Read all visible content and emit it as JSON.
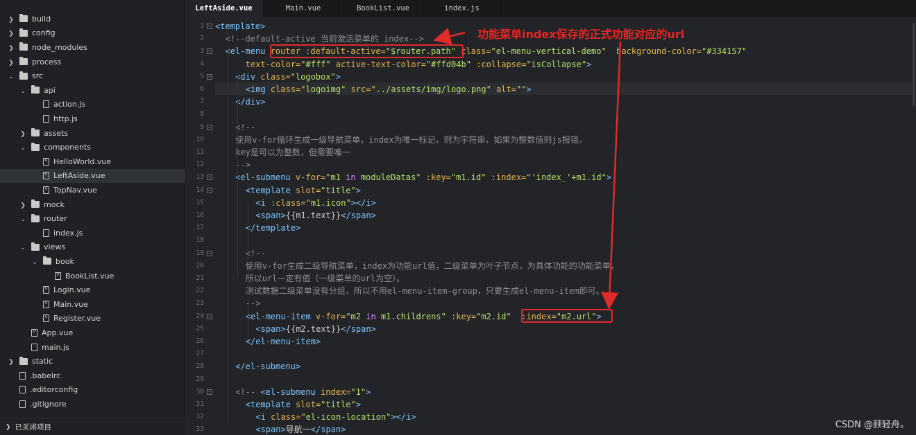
{
  "tabs": [
    {
      "label": "LeftAside.vue",
      "active": true
    },
    {
      "label": "Main.vue",
      "active": false
    },
    {
      "label": "BookList.vue",
      "active": false
    },
    {
      "label": "index.js",
      "active": false
    }
  ],
  "tree": [
    {
      "label": "build",
      "type": "folder",
      "depth": 0,
      "state": "collapsed"
    },
    {
      "label": "config",
      "type": "folder",
      "depth": 0,
      "state": "collapsed"
    },
    {
      "label": "node_modules",
      "type": "folder",
      "depth": 0,
      "state": "collapsed"
    },
    {
      "label": "process",
      "type": "folder",
      "depth": 0,
      "state": "collapsed"
    },
    {
      "label": "src",
      "type": "folder",
      "depth": 0,
      "state": "expanded"
    },
    {
      "label": "api",
      "type": "folder",
      "depth": 1,
      "state": "expanded"
    },
    {
      "label": "action.js",
      "type": "file",
      "depth": 2
    },
    {
      "label": "http.js",
      "type": "file",
      "depth": 2
    },
    {
      "label": "assets",
      "type": "folder",
      "depth": 1,
      "state": "collapsed"
    },
    {
      "label": "components",
      "type": "folder",
      "depth": 1,
      "state": "expanded"
    },
    {
      "label": "HelloWorld.vue",
      "type": "vue",
      "depth": 2
    },
    {
      "label": "LeftAside.vue",
      "type": "vue",
      "depth": 2,
      "selected": true
    },
    {
      "label": "TopNav.vue",
      "type": "vue",
      "depth": 2
    },
    {
      "label": "mock",
      "type": "folder",
      "depth": 1,
      "state": "collapsed"
    },
    {
      "label": "router",
      "type": "folder",
      "depth": 1,
      "state": "expanded"
    },
    {
      "label": "index.js",
      "type": "file",
      "depth": 2
    },
    {
      "label": "views",
      "type": "folder",
      "depth": 1,
      "state": "expanded"
    },
    {
      "label": "book",
      "type": "folder",
      "depth": 2,
      "state": "expanded"
    },
    {
      "label": "BookList.vue",
      "type": "vue",
      "depth": 3
    },
    {
      "label": "Login.vue",
      "type": "vue",
      "depth": 2
    },
    {
      "label": "Main.vue",
      "type": "vue",
      "depth": 2
    },
    {
      "label": "Register.vue",
      "type": "vue",
      "depth": 2
    },
    {
      "label": "App.vue",
      "type": "vue",
      "depth": 1
    },
    {
      "label": "main.js",
      "type": "file",
      "depth": 1
    },
    {
      "label": "static",
      "type": "folder",
      "depth": 0,
      "state": "collapsed"
    },
    {
      "label": ".babelrc",
      "type": "file",
      "depth": 0
    },
    {
      "label": ".editorconfig",
      "type": "file",
      "depth": 0
    },
    {
      "label": ".gitignore",
      "type": "file",
      "depth": 0
    }
  ],
  "sidebar_footer": "已关闭项目",
  "code_lines": [
    {
      "n": "1",
      "fold": "minus",
      "indent": 0,
      "tokens": [
        [
          "tg",
          "<template>"
        ]
      ]
    },
    {
      "n": "2",
      "indent": 1,
      "tokens": [
        [
          "cm",
          "<!--default-active 当前激活菜单的 index-->"
        ]
      ]
    },
    {
      "n": "3",
      "fold": "minus",
      "indent": 1,
      "tokens": [
        [
          "tg",
          "<el-menu "
        ],
        [
          "at",
          "router :default-active="
        ],
        [
          "st",
          "\"$router.path\""
        ],
        [
          "pl",
          " "
        ],
        [
          "at",
          "class="
        ],
        [
          "st",
          "\"el-menu-vertical-demo\""
        ],
        [
          "pl",
          "  "
        ],
        [
          "at",
          "background-color="
        ],
        [
          "st",
          "\"#334157\""
        ]
      ]
    },
    {
      "n": "4",
      "indent": 3,
      "tokens": [
        [
          "at",
          "text-color="
        ],
        [
          "st",
          "\"#fff\""
        ],
        [
          "pl",
          " "
        ],
        [
          "at",
          "active-text-color="
        ],
        [
          "st",
          "\"#ffd04b\""
        ],
        [
          "pl",
          " "
        ],
        [
          "at",
          ":collapse="
        ],
        [
          "st",
          "\"isCollapse\""
        ],
        [
          "tg",
          ">"
        ]
      ]
    },
    {
      "n": "5",
      "fold": "minus",
      "indent": 2,
      "tokens": [
        [
          "tg",
          "<div "
        ],
        [
          "at",
          "class="
        ],
        [
          "st",
          "\"logobox\""
        ],
        [
          "tg",
          ">"
        ]
      ]
    },
    {
      "n": "6",
      "indent": 3,
      "tokens": [
        [
          "tg",
          "<img "
        ],
        [
          "at",
          "class="
        ],
        [
          "st",
          "\"logoimg\""
        ],
        [
          "pl",
          " "
        ],
        [
          "at",
          "src="
        ],
        [
          "st",
          "\"../assets/img/logo.png\""
        ],
        [
          "pl",
          " "
        ],
        [
          "at",
          "alt="
        ],
        [
          "st",
          "\"\""
        ],
        [
          "tg",
          ">"
        ]
      ]
    },
    {
      "n": "7",
      "indent": 2,
      "tokens": [
        [
          "tg",
          "</div>"
        ]
      ]
    },
    {
      "n": "8",
      "indent": 0,
      "tokens": []
    },
    {
      "n": "9",
      "fold": "minus",
      "indent": 2,
      "tokens": [
        [
          "cm",
          "<!--"
        ]
      ]
    },
    {
      "n": "10",
      "indent": 2,
      "tokens": [
        [
          "cm",
          "使用v-for循环生成一级导航菜单，index为唯一标记，则为字符串，如果为整数值则js报错。"
        ]
      ]
    },
    {
      "n": "11",
      "indent": 2,
      "tokens": [
        [
          "cm",
          "key是可以为整数，但需要唯一"
        ]
      ]
    },
    {
      "n": "12",
      "indent": 2,
      "tokens": [
        [
          "cm",
          "-->"
        ]
      ]
    },
    {
      "n": "13",
      "fold": "minus",
      "indent": 2,
      "tokens": [
        [
          "tg",
          "<el-submenu "
        ],
        [
          "at",
          "v-for="
        ],
        [
          "st",
          "\"m1 "
        ],
        [
          "kw",
          "in"
        ],
        [
          "st",
          " moduleDatas\""
        ],
        [
          "pl",
          " "
        ],
        [
          "at",
          ":key="
        ],
        [
          "st",
          "\"m1.id\""
        ],
        [
          "pl",
          " "
        ],
        [
          "at",
          ":index="
        ],
        [
          "st",
          "\"'index_'+m1.id\""
        ],
        [
          "tg",
          ">"
        ]
      ]
    },
    {
      "n": "14",
      "fold": "minus",
      "indent": 3,
      "tokens": [
        [
          "tg",
          "<template "
        ],
        [
          "at",
          "slot="
        ],
        [
          "st",
          "\"title\""
        ],
        [
          "tg",
          ">"
        ]
      ]
    },
    {
      "n": "15",
      "indent": 4,
      "tokens": [
        [
          "tg",
          "<i "
        ],
        [
          "at",
          ":class="
        ],
        [
          "st",
          "\"m1.icon\""
        ],
        [
          "tg",
          "></i>"
        ]
      ]
    },
    {
      "n": "16",
      "indent": 4,
      "tokens": [
        [
          "tg",
          "<span>"
        ],
        [
          "pl",
          "{{m1.text}}"
        ],
        [
          "tg",
          "</span>"
        ]
      ]
    },
    {
      "n": "17",
      "indent": 3,
      "tokens": [
        [
          "tg",
          "</template>"
        ]
      ]
    },
    {
      "n": "18",
      "indent": 0,
      "tokens": []
    },
    {
      "n": "19",
      "fold": "minus",
      "indent": 3,
      "tokens": [
        [
          "cm",
          "<!--"
        ]
      ]
    },
    {
      "n": "20",
      "indent": 3,
      "tokens": [
        [
          "cm",
          "使用v-for生成二级导航菜单，index为功能url值，二级菜单为叶子节点，为具体功能的功能菜单，"
        ]
      ]
    },
    {
      "n": "21",
      "indent": 3,
      "tokens": [
        [
          "cm",
          "所以url一定有值（一级菜单的url为空）。"
        ]
      ]
    },
    {
      "n": "22",
      "indent": 3,
      "tokens": [
        [
          "cm",
          "测试数据二级菜单没有分组，所以不用el-menu-item-group，只要生成el-menu-item即可。"
        ]
      ]
    },
    {
      "n": "23",
      "indent": 3,
      "tokens": [
        [
          "cm",
          "-->"
        ]
      ]
    },
    {
      "n": "24",
      "fold": "minus",
      "indent": 3,
      "tokens": [
        [
          "tg",
          "<el-menu-item "
        ],
        [
          "at",
          "v-for="
        ],
        [
          "st",
          "\"m2 "
        ],
        [
          "kw",
          "in"
        ],
        [
          "st",
          " m1.childrens\""
        ],
        [
          "pl",
          " "
        ],
        [
          "at",
          ":key="
        ],
        [
          "st",
          "\"m2.id\""
        ],
        [
          "pl",
          "  "
        ],
        [
          "at",
          ":index="
        ],
        [
          "st",
          "\"m2.url\""
        ],
        [
          "tg",
          ">"
        ]
      ]
    },
    {
      "n": "25",
      "indent": 4,
      "tokens": [
        [
          "tg",
          "<span>"
        ],
        [
          "pl",
          "{{m2.text}}"
        ],
        [
          "tg",
          "</span>"
        ]
      ]
    },
    {
      "n": "26",
      "indent": 3,
      "tokens": [
        [
          "tg",
          "</el-menu-item>"
        ]
      ]
    },
    {
      "n": "27",
      "indent": 0,
      "tokens": []
    },
    {
      "n": "28",
      "indent": 2,
      "tokens": [
        [
          "tg",
          "</el-submenu>"
        ]
      ]
    },
    {
      "n": "29",
      "indent": 0,
      "tokens": []
    },
    {
      "n": "30",
      "fold": "minus",
      "indent": 2,
      "tokens": [
        [
          "cm",
          "<!-- "
        ],
        [
          "tg",
          "<el-submenu "
        ],
        [
          "at",
          "index="
        ],
        [
          "st",
          "\"1\""
        ],
        [
          "tg",
          ">"
        ]
      ]
    },
    {
      "n": "31",
      "indent": 3,
      "tokens": [
        [
          "tg",
          "<template "
        ],
        [
          "at",
          "slot="
        ],
        [
          "st",
          "\"title\""
        ],
        [
          "tg",
          ">"
        ]
      ]
    },
    {
      "n": "32",
      "indent": 4,
      "tokens": [
        [
          "tg",
          "<i "
        ],
        [
          "at",
          "class="
        ],
        [
          "st",
          "\"el-icon-location\""
        ],
        [
          "tg",
          "></i>"
        ]
      ]
    },
    {
      "n": "33",
      "indent": 4,
      "tokens": [
        [
          "tg",
          "<span>"
        ],
        [
          "pl",
          "导航一"
        ],
        [
          "tg",
          "</span>"
        ]
      ]
    }
  ],
  "annotation": {
    "note": "功能菜单index保存的正式功能对应的url",
    "color": "#e12a2a"
  },
  "watermark": "CSDN @顾轻舟。",
  "colors": {
    "tag": "#7ec6ff",
    "attribute": "#e6b450",
    "string": "#b8e06b",
    "comment": "#8e9196",
    "keyword": "#d48cf5",
    "background": "#232427"
  }
}
